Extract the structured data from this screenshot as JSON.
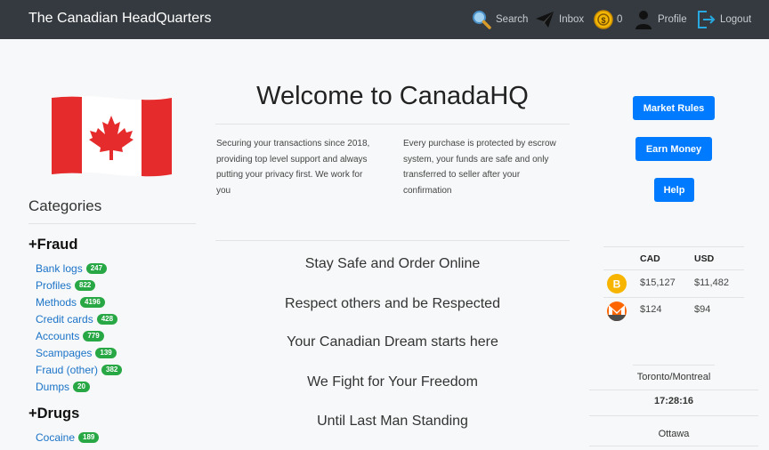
{
  "header": {
    "brand": "The Canadian HeadQuarters",
    "search_label": "Search",
    "inbox_label": "Inbox",
    "wallet_balance": "0",
    "profile_label": "Profile",
    "logout_label": "Logout"
  },
  "sidebar": {
    "title": "Categories",
    "sections": [
      {
        "title": "+Fraud",
        "items": [
          {
            "label": "Bank logs",
            "count": "247"
          },
          {
            "label": "Profiles",
            "count": "822"
          },
          {
            "label": "Methods",
            "count": "4196"
          },
          {
            "label": "Credit cards",
            "count": "428"
          },
          {
            "label": "Accounts",
            "count": "779"
          },
          {
            "label": "Scampages",
            "count": "139"
          },
          {
            "label": "Fraud (other)",
            "count": "382"
          },
          {
            "label": "Dumps",
            "count": "20"
          }
        ]
      },
      {
        "title": "+Drugs",
        "items": [
          {
            "label": "Cocaine",
            "count": "189"
          }
        ]
      }
    ]
  },
  "main": {
    "welcome": "Welcome to CanadaHQ",
    "intro_left": "Securing your transactions since 2018, providing top level support and always putting your privacy first. We work for you",
    "intro_right": "Every purchase is protected by escrow system, your funds are safe and only transferred to seller after your confirmation",
    "mottos": [
      "Stay Safe and Order Online",
      "Respect others and be Respected",
      "Your Canadian Dream starts here",
      "We Fight for Your Freedom",
      "Until Last Man Standing"
    ]
  },
  "right_panel": {
    "buttons": {
      "rules": "Market Rules",
      "earn": "Earn Money",
      "help": "Help"
    },
    "price_table": {
      "headers": [
        "CAD",
        "USD"
      ],
      "rows": [
        {
          "coin": "bitcoin-icon",
          "cad": "$15,127",
          "usd": "$11,482"
        },
        {
          "coin": "monero-icon",
          "cad": "$124",
          "usd": "$94"
        }
      ]
    },
    "clock": {
      "city1": "Toronto/Montreal",
      "time1": "17:28:16",
      "city2": "Ottawa"
    }
  },
  "colors": {
    "navbar": "#343a40",
    "primary": "#007bff",
    "badge": "#28a745",
    "link": "#1a73c8",
    "flag_red": "#e52b2b"
  }
}
